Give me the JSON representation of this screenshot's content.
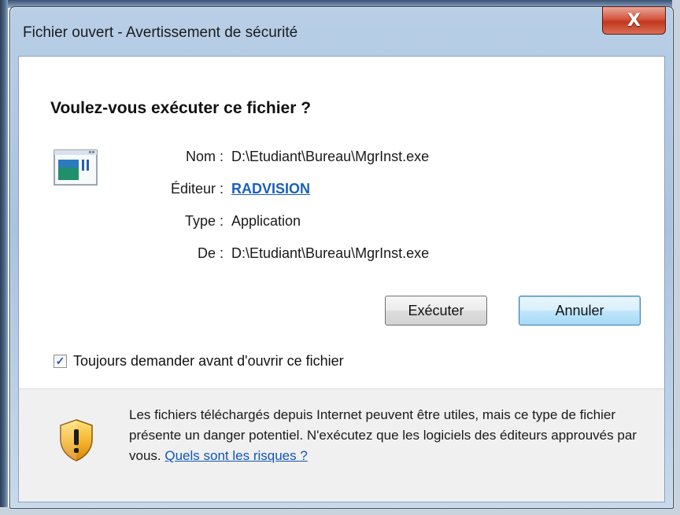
{
  "window": {
    "title": "Fichier ouvert - Avertissement de sécurité",
    "close_glyph": "X"
  },
  "dialog": {
    "question": "Voulez-vous exécuter ce fichier ?",
    "file_icon": "application-window-icon",
    "fields": {
      "name_label": "Nom :",
      "name_value": "D:\\Etudiant\\Bureau\\MgrInst.exe",
      "publisher_label": "Éditeur :",
      "publisher_value": "RADVISION",
      "type_label": "Type :",
      "type_value": "Application",
      "from_label": "De :",
      "from_value": "D:\\Etudiant\\Bureau\\MgrInst.exe"
    },
    "buttons": {
      "run_label": "Exécuter",
      "cancel_label": "Annuler"
    },
    "checkbox": {
      "label": "Toujours demander avant d'ouvrir ce fichier",
      "checked": true,
      "check_glyph": "✓"
    },
    "warning": {
      "icon": "security-shield-warning-icon",
      "text": "Les fichiers téléchargés depuis Internet peuvent être utiles, mais ce type de fichier présente un danger potentiel. N'exécutez que les logiciels des éditeurs approuvés par vous.",
      "link": "Quels sont les risques ?"
    }
  },
  "colors": {
    "link": "#1255b8",
    "close_button": "#c2371f",
    "default_button_border": "#3c7fb1"
  }
}
